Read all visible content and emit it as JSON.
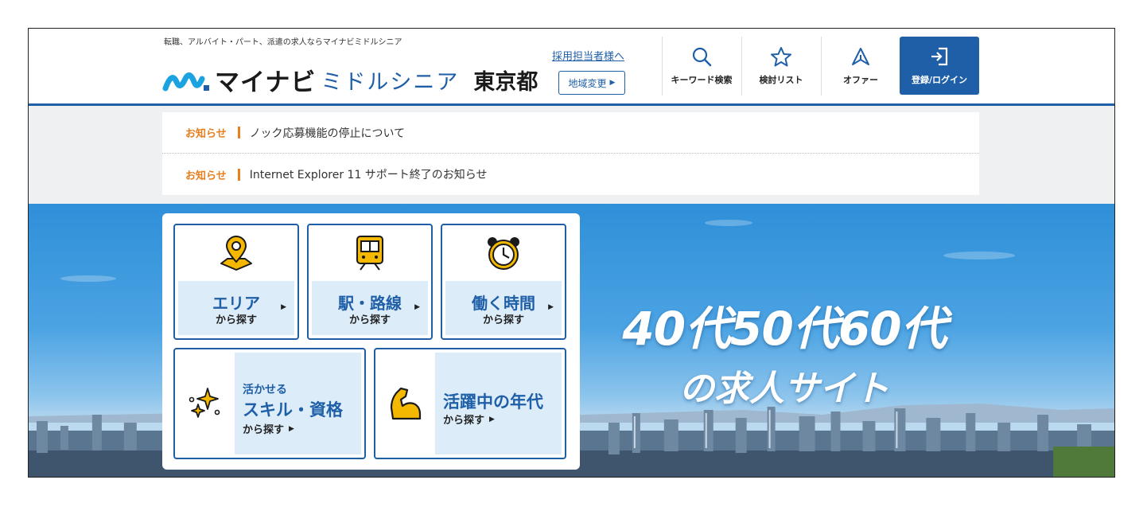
{
  "header": {
    "tagline": "転職、アルバイト・パート、派遣の求人ならマイナビミドルシニア",
    "logo_main": "マイナビ",
    "logo_sub": "ミドルシニア",
    "logo_prefecture": "東京都",
    "recruiter_link": "採用担当者様へ",
    "region_button": "地域変更",
    "nav": {
      "keyword": "キーワード検索",
      "list": "検討リスト",
      "offer": "オファー",
      "login": "登録/ログイン"
    }
  },
  "notices": [
    {
      "tag": "お知らせ",
      "text": "ノック応募機能の停止について"
    },
    {
      "tag": "お知らせ",
      "text": "Internet Explorer 11 サポート終了のお知らせ"
    }
  ],
  "search": {
    "area": {
      "title": "エリア",
      "sub": "から探す"
    },
    "station": {
      "title": "駅・路線",
      "sub": "から探す"
    },
    "time": {
      "title": "働く時間",
      "sub": "から探す"
    },
    "skill": {
      "small": "活かせる",
      "big": "スキル・資格",
      "sub": "から探す"
    },
    "age": {
      "big": "活躍中の年代",
      "sub": "から探す"
    }
  },
  "hero": {
    "line1": "40代50代60代",
    "line2": "の求人サイト"
  },
  "colors": {
    "brand_blue": "#1f5fa8",
    "accent_orange": "#e87e1e",
    "icon_yellow": "#f5b800",
    "logo_cyan": "#1aa3e0"
  }
}
